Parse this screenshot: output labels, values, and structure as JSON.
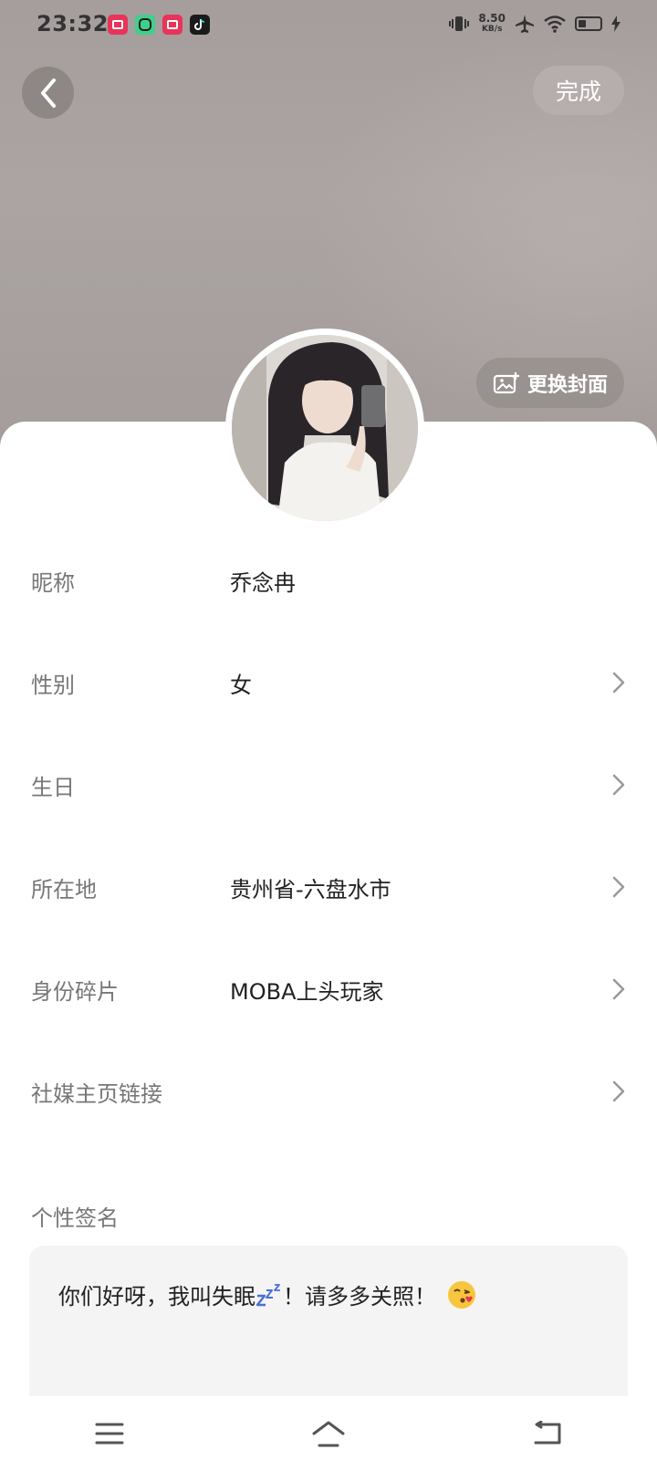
{
  "status_bar": {
    "time": "23:32",
    "app_icons": [
      {
        "name": "video-app-icon",
        "color": "#e8345a"
      },
      {
        "name": "camera-app-icon",
        "color": "#3fd08c"
      },
      {
        "name": "video-app-icon-2",
        "color": "#e8345a"
      },
      {
        "name": "tiktok-icon",
        "color": "#1b1b1b"
      }
    ],
    "net_speed": "8.50",
    "net_unit": "KB/s",
    "icons": [
      "vibrate-icon",
      "airplane-icon",
      "wifi-icon",
      "battery-icon",
      "charging-icon"
    ]
  },
  "header": {
    "back_icon": "chevron-left-icon",
    "done_label": "完成",
    "change_cover_label": "更换封面",
    "change_cover_icon": "image-add-icon"
  },
  "profile_fields": [
    {
      "key": "nickname",
      "label": "昵称",
      "value": "乔念冉",
      "has_arrow": false
    },
    {
      "key": "gender",
      "label": "性别",
      "value": "女",
      "has_arrow": true
    },
    {
      "key": "birthday",
      "label": "生日",
      "value": "",
      "has_arrow": true
    },
    {
      "key": "location",
      "label": "所在地",
      "value": "贵州省-六盘水市",
      "has_arrow": true
    },
    {
      "key": "identity",
      "label": "身份碎片",
      "value": "MOBA上头玩家",
      "has_arrow": true
    },
    {
      "key": "social",
      "label": "社媒主页链接",
      "value": "",
      "has_arrow": true
    }
  ],
  "signature": {
    "label": "个性签名",
    "text_part1": "你们好呀，我叫失眠",
    "text_part2": "！请多多关照！",
    "emoji_names": [
      "zzz-emoji",
      "kissing-face-emoji"
    ]
  },
  "colors": {
    "cover_bg": "#a59e9c",
    "label_gray": "#777777",
    "value_dark": "#222222",
    "sig_box_bg": "#f5f4f4"
  },
  "nav": {
    "icons": [
      "menu-icon",
      "home-icon",
      "back-icon"
    ]
  }
}
